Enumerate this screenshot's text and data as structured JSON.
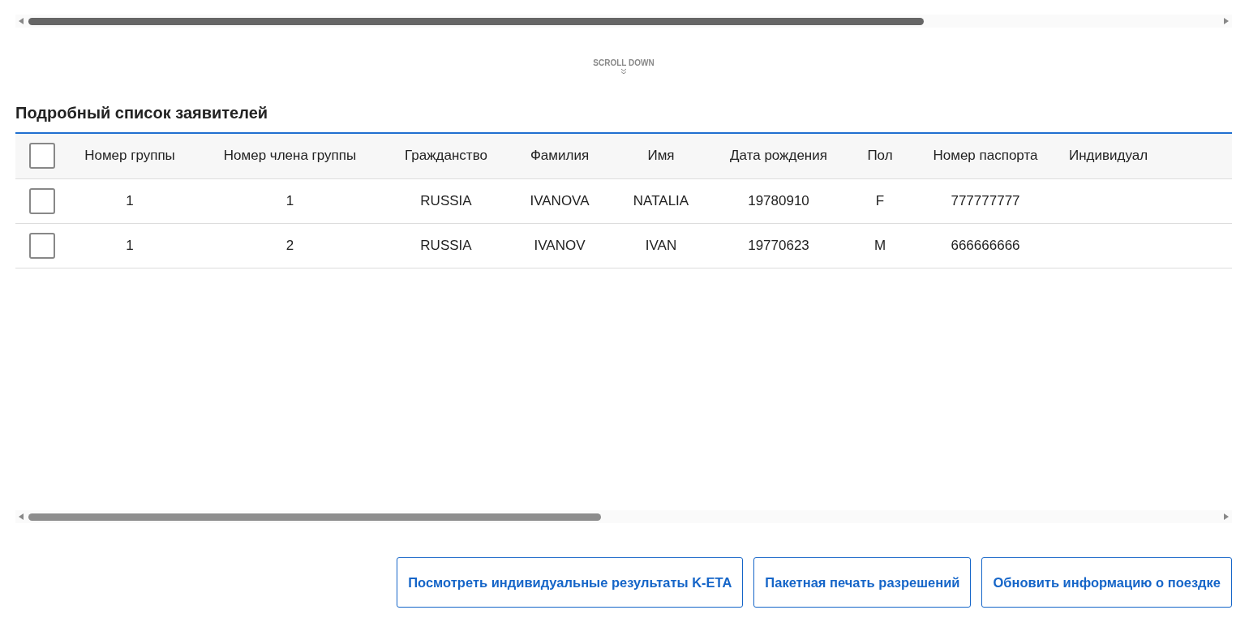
{
  "scroll_hint": {
    "label": "SCROLL DOWN"
  },
  "applicants": {
    "title": "Подробный список заявителей",
    "select_all": {
      "checked": false
    },
    "columns": [
      "Номер группы",
      "Номер члена группы",
      "Гражданство",
      "Фамилия",
      "Имя",
      "Дата рождения",
      "Пол",
      "Номер паспорта",
      "Индивидуал"
    ],
    "rows": [
      {
        "checked": false,
        "cells": [
          "1",
          "1",
          "RUSSIA",
          "IVANOVA",
          "NATALIA",
          "19780910",
          "F",
          "777777777",
          ""
        ]
      },
      {
        "checked": false,
        "cells": [
          "1",
          "2",
          "RUSSIA",
          "IVANOV",
          "IVAN",
          "19770623",
          "M",
          "666666666",
          ""
        ]
      }
    ]
  },
  "buttons": [
    "Посмотреть индивидуальные результаты K-ETA",
    "Пакетная печать разрешений",
    "Обновить информацию о поездке"
  ]
}
